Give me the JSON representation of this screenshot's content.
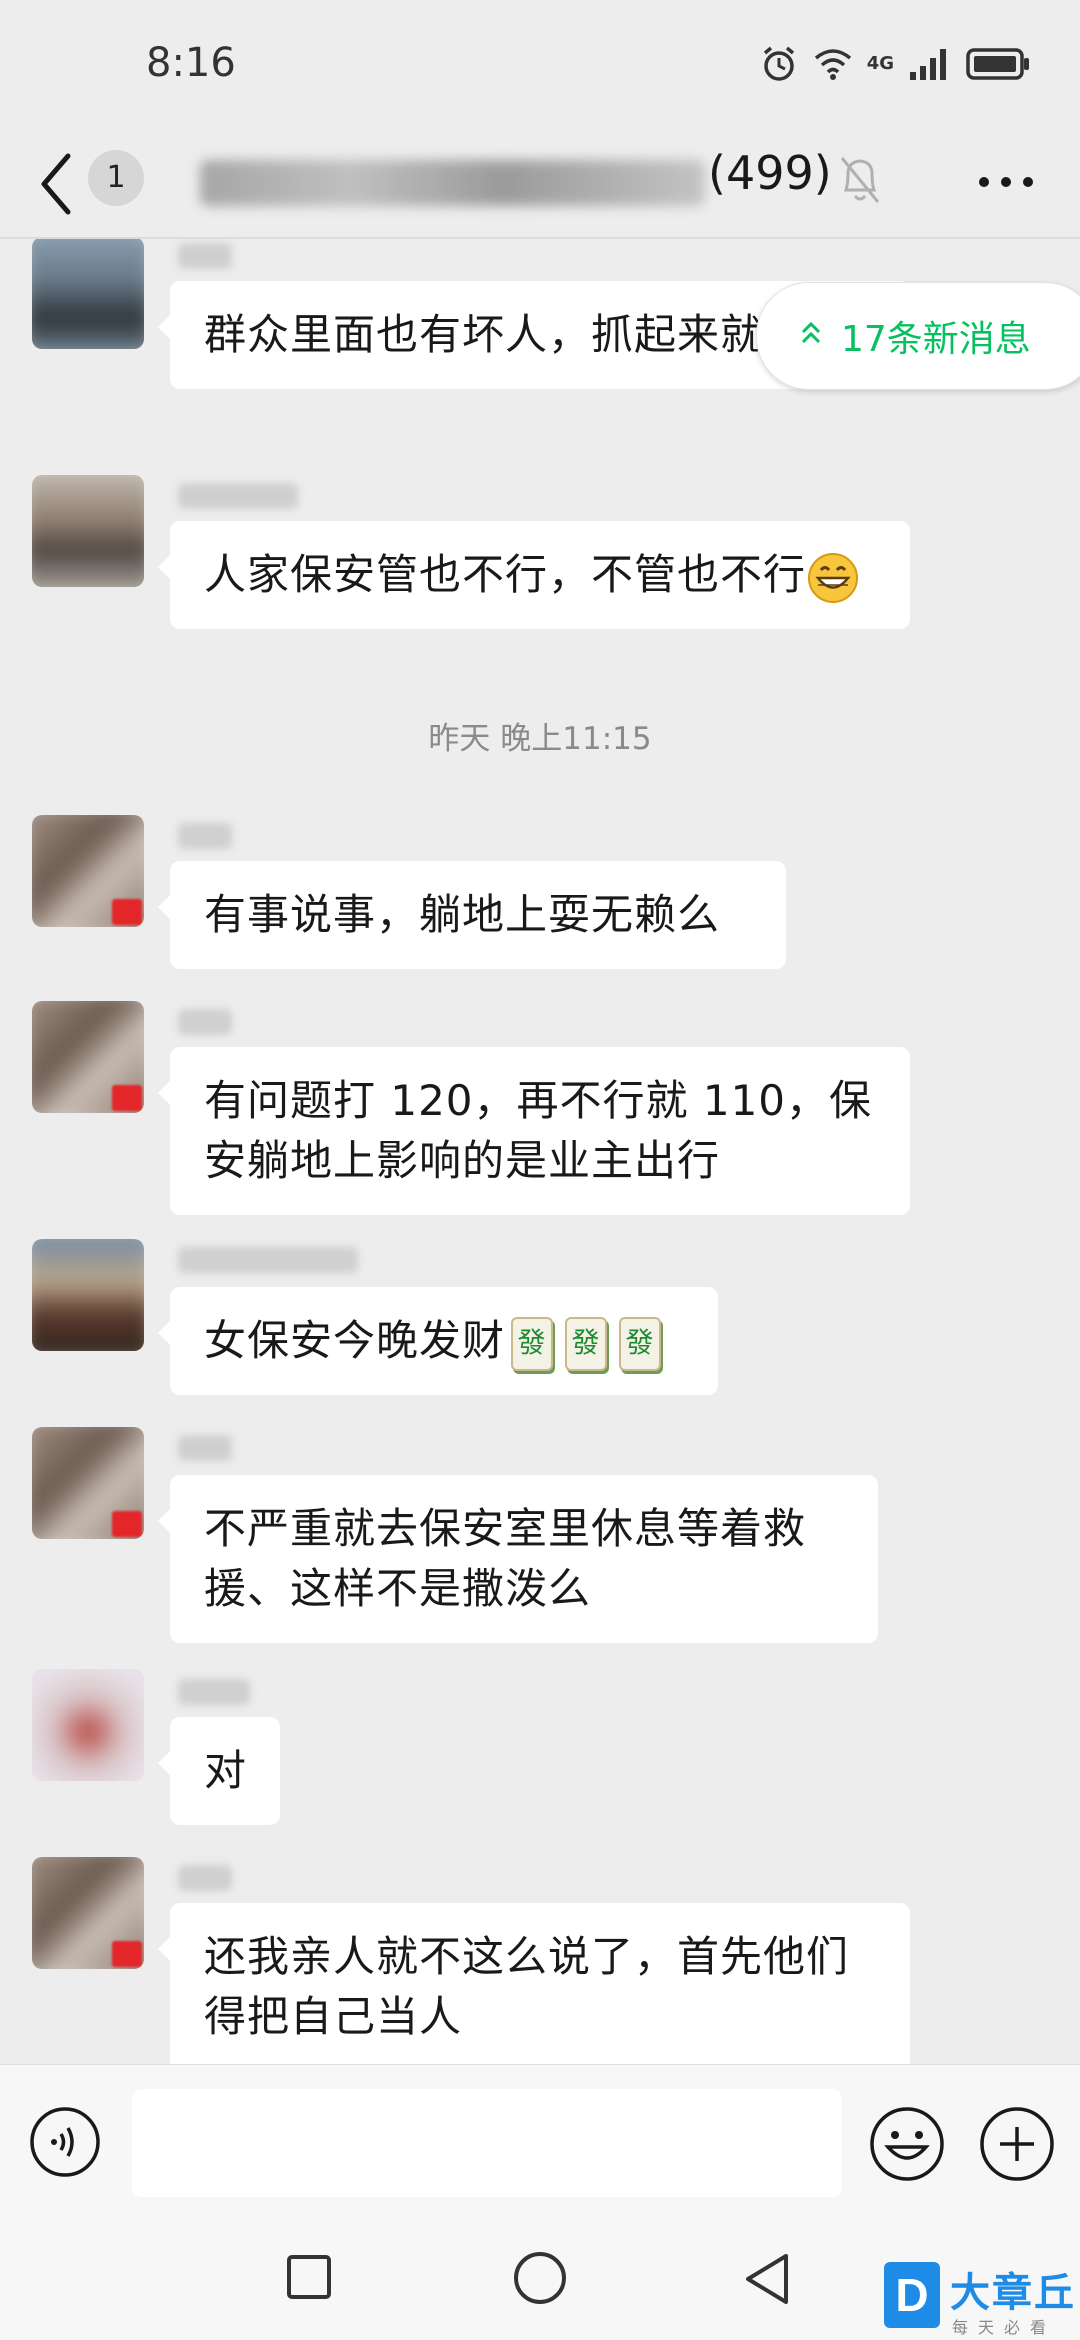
{
  "status_bar": {
    "time": "8:16",
    "network": "4G"
  },
  "header": {
    "back_badge": "1",
    "title_count": "(499)"
  },
  "new_messages_pill": {
    "label": "17条新消息"
  },
  "timestamp": "昨天 晚上11:15",
  "messages": [
    {
      "text": "群众里面也有坏人，抓起来就好了"
    },
    {
      "text": "人家保安管也不行，不管也不行"
    },
    {
      "text": "有事说事，躺地上耍无赖么"
    },
    {
      "text": "有问题打 120，再不行就 110，保安躺地上影响的是业主出行"
    },
    {
      "text": "女保安今晚发财"
    },
    {
      "text": "不严重就去保安室里休息等着救援、这样不是撒泼么"
    },
    {
      "text": "对"
    },
    {
      "text": "还我亲人就不这么说了，首先他们得把自己当人"
    }
  ],
  "emoji": {
    "grin": "grinning-face",
    "mahjong": "發"
  },
  "watermark": {
    "logo": "D",
    "name": "大章丘",
    "tagline": "每天必看"
  },
  "colors": {
    "accent": "#07c160",
    "background": "#ededed",
    "bubble": "#ffffff"
  }
}
